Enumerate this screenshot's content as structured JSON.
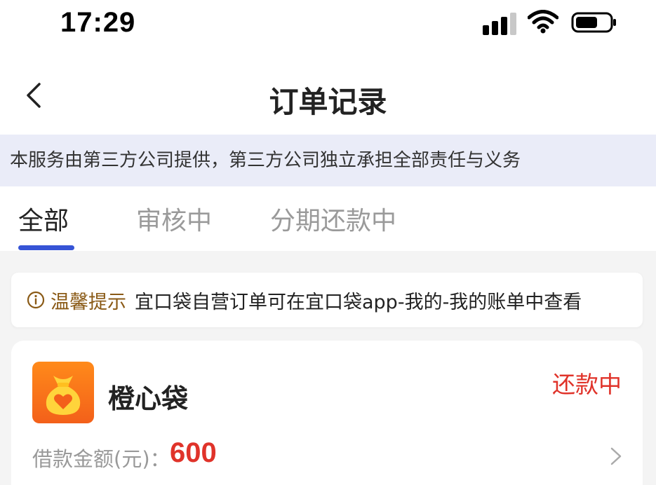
{
  "status_bar": {
    "time": "17:29",
    "icons": [
      "cellular-signal-icon",
      "wifi-icon",
      "battery-icon"
    ]
  },
  "nav": {
    "title": "订单记录",
    "back_icon": "chevron-left-icon"
  },
  "notice": {
    "text": "本服务由第三方公司提供，第三方公司独立承担全部责任与义务"
  },
  "tabs": [
    {
      "label": "全部",
      "active": true
    },
    {
      "label": "审核中",
      "active": false
    },
    {
      "label": "分期还款中",
      "active": false
    }
  ],
  "tip": {
    "icon": "info-circle-icon",
    "label": "温馨提示",
    "text": "宜口袋自营订单可在宜口袋app-我的-我的账单中查看"
  },
  "orders": [
    {
      "logo_icon": "money-bag-heart-icon",
      "name": "橙心袋",
      "status": "还款中",
      "amount_label": "借款金额(元)：",
      "amount": "600"
    }
  ],
  "colors": {
    "accent_blue": "#3654d6",
    "status_red": "#e0332a",
    "tip_brown": "#8a5a16",
    "notice_bg": "#eaecf8",
    "logo_orange": "#f3601a"
  }
}
